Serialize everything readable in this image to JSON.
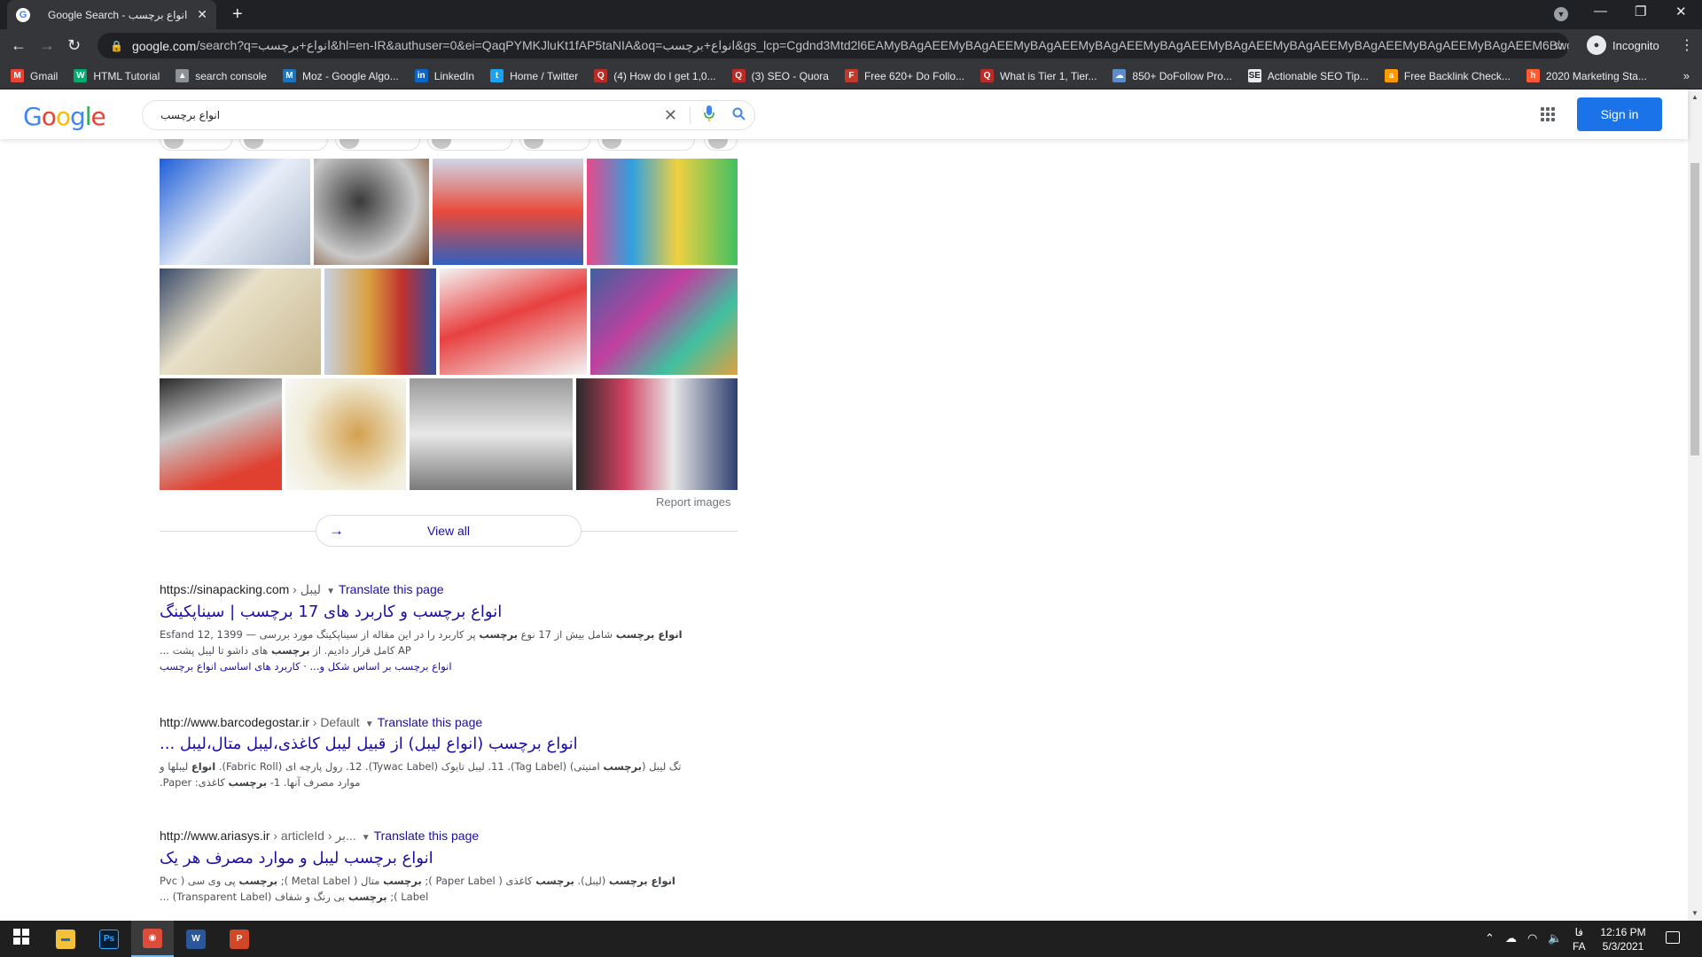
{
  "browser": {
    "tab_title": "Google Search - انواع برچسب",
    "favicon_letter": "G",
    "url_host": "google.com",
    "url_rest": "/search?q=انواع+برچسب&hl=en-IR&authuser=0&ei=QaqPYMKJluKt1fAP5taNIA&oq=انواع+برچسب&gs_lcp=Cgdnd3Mtd2l6EAMyBAgAEEMyBAgAEEMyBAgAEEMyBAgAEEMyBAgAEEMyBAgAEEMyBAgAEEMyBAgAEEMyBAgAEEMyBAgAEEM6Bwg...",
    "incognito_label": "Incognito",
    "bookmarks": [
      {
        "label": "Gmail",
        "icon": "gmail-icon",
        "color": "#ea4335",
        "glyph": "M"
      },
      {
        "label": "HTML Tutorial",
        "icon": "w3schools-icon",
        "color": "#04aa6d",
        "glyph": "W"
      },
      {
        "label": "search console",
        "icon": "search-console-icon",
        "color": "#8e9297",
        "glyph": "▲"
      },
      {
        "label": "Moz - Google Algo...",
        "icon": "moz-icon",
        "color": "#1e73be",
        "glyph": "M"
      },
      {
        "label": "LinkedIn",
        "icon": "linkedin-icon",
        "color": "#0a66c2",
        "glyph": "in"
      },
      {
        "label": "Home / Twitter",
        "icon": "twitter-icon",
        "color": "#1da1f2",
        "glyph": "t"
      },
      {
        "label": "(4) How do I get 1,0...",
        "icon": "quora-icon",
        "color": "#b92b27",
        "glyph": "Q"
      },
      {
        "label": "(3) SEO - Quora",
        "icon": "quora-icon",
        "color": "#b92b27",
        "glyph": "Q"
      },
      {
        "label": "Free 620+ Do Follo...",
        "icon": "globe-icon",
        "color": "#c0392b",
        "glyph": "F"
      },
      {
        "label": "What is Tier 1, Tier...",
        "icon": "quora-icon",
        "color": "#b92b27",
        "glyph": "Q"
      },
      {
        "label": "850+ DoFollow Pro...",
        "icon": "cloud-icon",
        "color": "#5b8ec9",
        "glyph": "☁"
      },
      {
        "label": "Actionable SEO Tip...",
        "icon": "seo-icon",
        "color": "#e8eaed",
        "glyph": "SE"
      },
      {
        "label": "Free Backlink Check...",
        "icon": "amazon-icon",
        "color": "#ff9900",
        "glyph": "a"
      },
      {
        "label": "2020 Marketing Sta...",
        "icon": "hubspot-icon",
        "color": "#ff5c35",
        "glyph": "h"
      }
    ]
  },
  "google": {
    "logo": [
      "G",
      "o",
      "o",
      "g",
      "l",
      "e"
    ],
    "query": "انواع برچسب",
    "sign_in": "Sign in"
  },
  "images": {
    "report_label": "Report images",
    "view_all_label": "View all"
  },
  "results": [
    {
      "url": "https://sinapacking.com",
      "path": " › لیبل",
      "translate": "Translate this page",
      "title": "انواع برچسب و کاربرد های 17 برچسب | سیناپکینگ",
      "snippet_html": "<b>انواع برچسب</b> شامل بیش از 17 نوع <b>برچسب</b> پر کاربرد را در این مقاله از سیناپکینگ مورد بررسی — Esfand 12, 1399 AP کامل قرار دادیم. از <b>برچسب</b> های داشو تا لیبل پشت ...",
      "sitelinks": "انواع برچسب بر اساس شکل و... · کاربرد های اساسی انواع برچسب"
    },
    {
      "url": "http://www.barcodegostar.ir",
      "path": " › Default",
      "translate": "Translate this page",
      "title": "انواع برچسب (انواع لیبل) از قبیل لیبل کاغذی،لیبل متال،لیبل ...",
      "snippet_html": "تگ لیبل (<b>برچسب</b> امنیتی) (Tag Label). 11. لیبل تایوک (Tywac Label). 12. رول پارچه ای (Fabric Roll). <b>انواع</b> لیبلها و موارد مصرف آنها. 1- <b>برچسب</b> کاغذی: Paper.",
      "sitelinks": ""
    },
    {
      "url": "http://www.ariasys.ir",
      "path": " › articleId › بر...",
      "translate": "Translate this page",
      "title": "انواع برچسب لیبل و موارد مصرف هر یک",
      "snippet_html": "<b>انواع برچسب</b> (لیبل). <b>برچسب</b> کاغذی ( Paper Label ); <b>برچسب</b> متال ( Metal Label ); <b>برچسب</b> پی وی سی ( Pvc Label ); <b>برچسب</b> بی رنگ و شفاف (Transparent Label) ...",
      "sitelinks": ""
    }
  ],
  "taskbar": {
    "apps": [
      {
        "name": "start",
        "icon": "windows-icon"
      },
      {
        "name": "file-explorer",
        "icon": "folder-icon",
        "color": "#f3c03b",
        "glyph": "▬"
      },
      {
        "name": "photoshop",
        "icon": "photoshop-icon",
        "color": "#001e36",
        "glyph": "Ps"
      },
      {
        "name": "chrome",
        "icon": "chrome-icon",
        "color": "#dd4b39",
        "glyph": "◉"
      },
      {
        "name": "word",
        "icon": "word-icon",
        "color": "#2b579a",
        "glyph": "W"
      },
      {
        "name": "powerpoint",
        "icon": "powerpoint-icon",
        "color": "#d24726",
        "glyph": "P"
      }
    ],
    "language": "فا",
    "language_code": "FA",
    "time": "12:16 PM",
    "date": "5/3/2021"
  }
}
